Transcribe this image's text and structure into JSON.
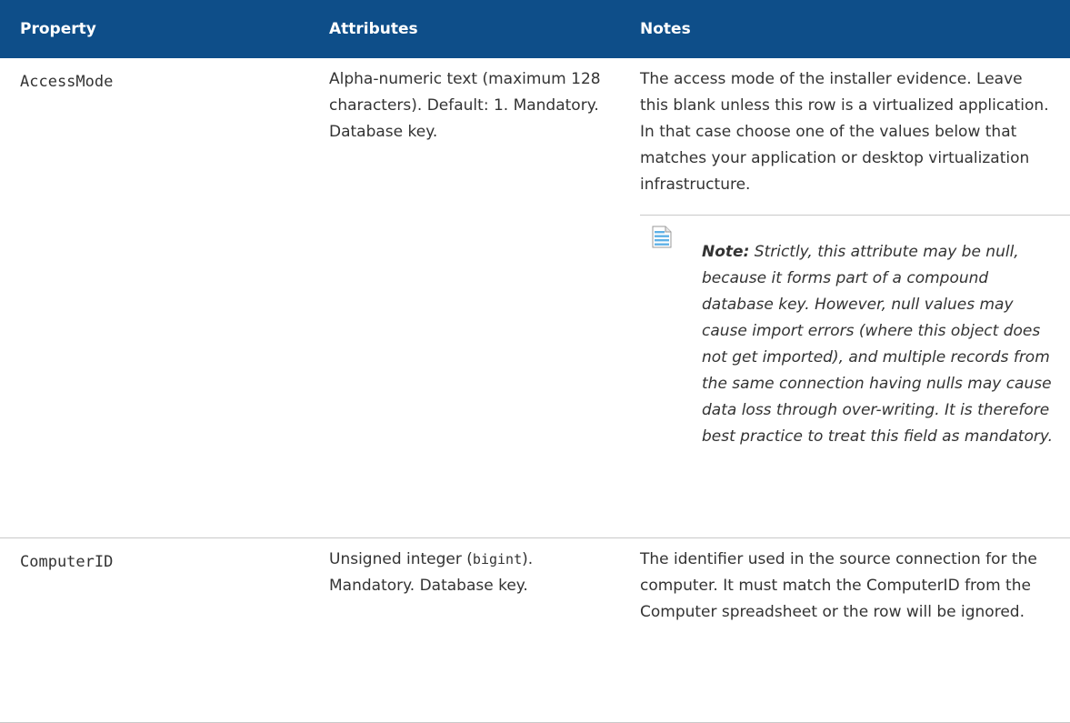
{
  "headers": {
    "property": "Property",
    "attributes": "Attributes",
    "notes": "Notes"
  },
  "rows": [
    {
      "property": "AccessMode",
      "attributes": "Alpha-numeric text (maximum 128 characters). Default: 1. Mandatory. Database key.",
      "notes": "The access mode of the installer evidence. Leave this blank unless this row is a virtualized application. In that case choose one of the values below that matches your application or desktop virtualization infrastructure.",
      "note": {
        "label": "Note:",
        "text": "Strictly, this attribute may be null, because it forms part of a compound database key. However, null values may cause import errors (where this object does not get imported), and multiple records from the same connection having nulls may cause data loss through over-writing. It is therefore best practice to treat this field as mandatory."
      }
    },
    {
      "property": "ComputerID",
      "attributes_before": "Unsigned integer (",
      "attributes_code": "bigint",
      "attributes_after": "). Mandatory. Database key.",
      "notes": "The identifier used in the source connection for the computer. It must match the ComputerID from the Computer spreadsheet or the row will be ignored."
    }
  ],
  "colors": {
    "header_bg": "#0e4e89",
    "header_text": "#ffffff",
    "rule": "#c9c9c9",
    "note_icon": "#5fb1e6"
  },
  "icons": {
    "note": "note-page-icon"
  }
}
